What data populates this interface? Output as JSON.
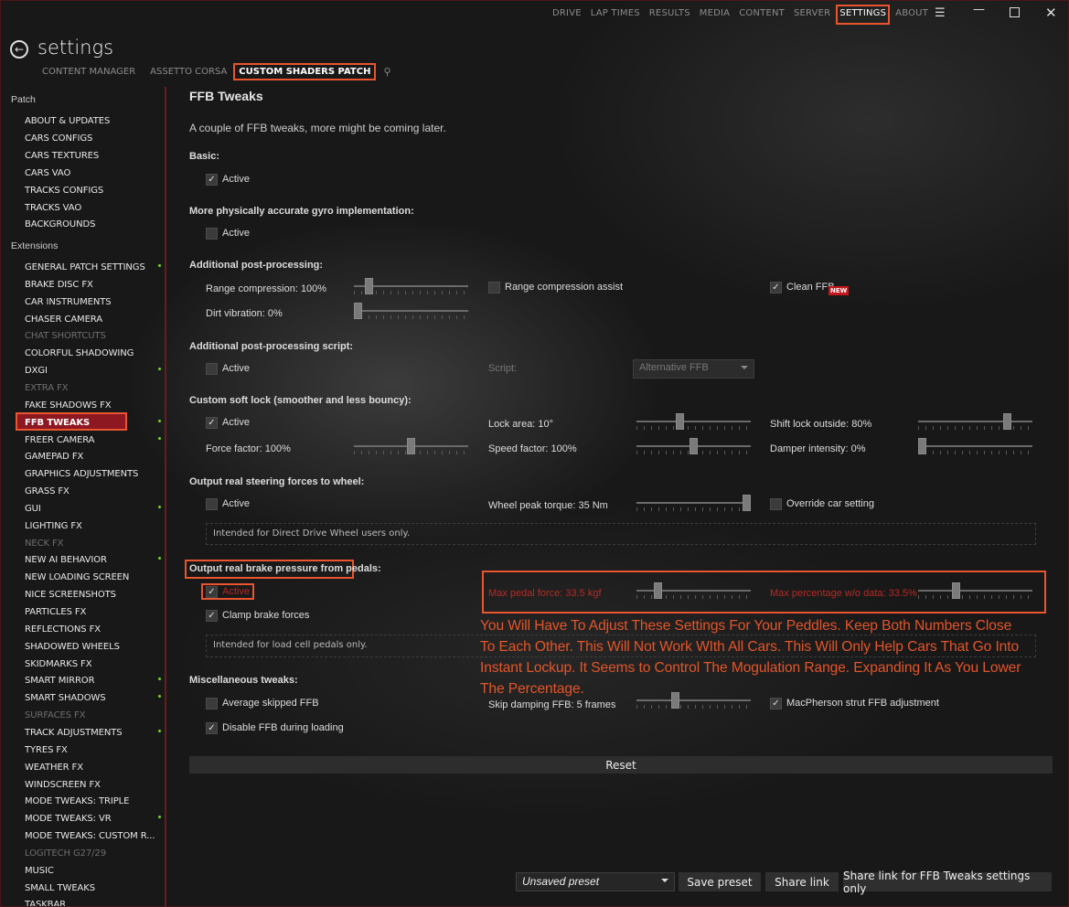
{
  "topnav": {
    "items": [
      "DRIVE",
      "LAP TIMES",
      "RESULTS",
      "MEDIA",
      "CONTENT",
      "SERVER",
      "SETTINGS",
      "ABOUT"
    ],
    "active": "SETTINGS"
  },
  "window": {
    "menu_icon": "hamburger-icon",
    "min_icon": "minimize-icon",
    "max_icon": "maximize-icon",
    "close_icon": "close-icon"
  },
  "page": {
    "title": "settings"
  },
  "subtabs": {
    "items": [
      "CONTENT MANAGER",
      "ASSETTO CORSA",
      "CUSTOM SHADERS PATCH"
    ],
    "active": "CUSTOM SHADERS PATCH",
    "search_icon": "search-icon"
  },
  "sidebar": {
    "patch_heading": "Patch",
    "patch_items": [
      "ABOUT & UPDATES",
      "CARS CONFIGS",
      "CARS TEXTURES",
      "CARS VAO",
      "TRACKS CONFIGS",
      "TRACKS VAO",
      "BACKGROUNDS"
    ],
    "ext_heading": "Extensions",
    "ext_items": [
      {
        "label": "GENERAL PATCH SETTINGS",
        "dim": false,
        "dot": true
      },
      {
        "label": "BRAKE DISC FX",
        "dim": false,
        "dot": false
      },
      {
        "label": "CAR INSTRUMENTS",
        "dim": false,
        "dot": false
      },
      {
        "label": "CHASER CAMERA",
        "dim": false,
        "dot": false
      },
      {
        "label": "CHAT SHORTCUTS",
        "dim": true,
        "dot": false
      },
      {
        "label": "COLORFUL SHADOWING",
        "dim": false,
        "dot": false
      },
      {
        "label": "DXGI",
        "dim": false,
        "dot": true
      },
      {
        "label": "EXTRA FX",
        "dim": true,
        "dot": false
      },
      {
        "label": "FAKE SHADOWS FX",
        "dim": false,
        "dot": false
      },
      {
        "label": "FFB TWEAKS",
        "dim": false,
        "dot": true,
        "selected": true
      },
      {
        "label": "FREER CAMERA",
        "dim": false,
        "dot": true
      },
      {
        "label": "GAMEPAD FX",
        "dim": false,
        "dot": false
      },
      {
        "label": "GRAPHICS ADJUSTMENTS",
        "dim": false,
        "dot": false
      },
      {
        "label": "GRASS FX",
        "dim": false,
        "dot": false
      },
      {
        "label": "GUI",
        "dim": false,
        "dot": true
      },
      {
        "label": "LIGHTING FX",
        "dim": false,
        "dot": false
      },
      {
        "label": "NECK FX",
        "dim": true,
        "dot": false
      },
      {
        "label": "NEW AI BEHAVIOR",
        "dim": false,
        "dot": true
      },
      {
        "label": "NEW LOADING SCREEN",
        "dim": false,
        "dot": false
      },
      {
        "label": "NICE SCREENSHOTS",
        "dim": false,
        "dot": false
      },
      {
        "label": "PARTICLES FX",
        "dim": false,
        "dot": false
      },
      {
        "label": "REFLECTIONS FX",
        "dim": false,
        "dot": false
      },
      {
        "label": "SHADOWED WHEELS",
        "dim": false,
        "dot": false
      },
      {
        "label": "SKIDMARKS FX",
        "dim": false,
        "dot": false
      },
      {
        "label": "SMART MIRROR",
        "dim": false,
        "dot": true
      },
      {
        "label": "SMART SHADOWS",
        "dim": false,
        "dot": true
      },
      {
        "label": "SURFACES FX",
        "dim": true,
        "dot": false
      },
      {
        "label": "TRACK ADJUSTMENTS",
        "dim": false,
        "dot": true
      },
      {
        "label": "TYRES FX",
        "dim": false,
        "dot": false
      },
      {
        "label": "WEATHER FX",
        "dim": false,
        "dot": false
      },
      {
        "label": "WINDSCREEN FX",
        "dim": false,
        "dot": false
      },
      {
        "label": "MODE TWEAKS: TRIPLE",
        "dim": false,
        "dot": false
      },
      {
        "label": "MODE TWEAKS: VR",
        "dim": false,
        "dot": true
      },
      {
        "label": "MODE TWEAKS: CUSTOM R...",
        "dim": false,
        "dot": false
      },
      {
        "label": "LOGITECH G27/29",
        "dim": true,
        "dot": false
      },
      {
        "label": "MUSIC",
        "dim": false,
        "dot": false
      },
      {
        "label": "SMALL TWEAKS",
        "dim": false,
        "dot": false
      },
      {
        "label": "TASKBAR",
        "dim": false,
        "dot": false
      }
    ]
  },
  "main": {
    "title": "FFB Tweaks",
    "description": "A couple of FFB tweaks, more might be coming later.",
    "basic": {
      "heading": "Basic:",
      "active_label": "Active",
      "active": true
    },
    "gyro": {
      "heading": "More physically accurate gyro implementation:",
      "active_label": "Active",
      "active": false
    },
    "post": {
      "heading": "Additional post-processing:",
      "range_label": "Range compression: 100%",
      "range_value": 0.1,
      "dirt_label": "Dirt vibration: 0%",
      "dirt_value": 0,
      "assist_label": "Range compression assist",
      "assist": false,
      "clean_label": "Clean FFB",
      "clean": true,
      "new_badge": "NEW"
    },
    "script": {
      "heading": "Additional post-processing script:",
      "active_label": "Active",
      "active": false,
      "script_label": "Script:",
      "script_value": "Alternative FFB"
    },
    "softlock": {
      "heading": "Custom soft lock (smoother and less bouncy):",
      "active_label": "Active",
      "active": true,
      "lock_label": "Lock area: 10°",
      "lock_value": 0.37,
      "shift_label": "Shift lock outside: 80%",
      "shift_value": 0.8,
      "force_label": "Force factor: 100%",
      "force_value": 0.5,
      "speed_label": "Speed factor: 100%",
      "speed_value": 0.5,
      "damper_label": "Damper intensity: 0%",
      "damper_value": 0
    },
    "steering": {
      "heading": "Output real steering forces to wheel:",
      "active_label": "Active",
      "active": false,
      "torque_label": "Wheel peak torque: 35 Nm",
      "torque_value": 1.0,
      "override_label": "Override car setting",
      "override": false,
      "note": "Intended for Direct Drive Wheel users only."
    },
    "brake": {
      "heading": "Output real brake pressure from pedals:",
      "active_label": "Active",
      "active": true,
      "clamp_label": "Clamp brake forces",
      "clamp": true,
      "maxforce_label": "Max pedal force: 33.5 kgf",
      "maxforce_value": 0.16,
      "maxperc_label": "Max percentage w/o data: 33.5%",
      "maxperc_value": 0.32,
      "note": "Intended for load cell pedals only."
    },
    "annotation": "You Will Have To Adjust These Settings For Your Peddles. Keep Both Numbers Close To Each Other.  This Will Not Work WIth All Cars. This Will Only Help Cars That Go Into Instant Lockup.  It Seems to Control The Mogulation Range. Expanding It As You Lower The Percentage.",
    "misc": {
      "heading": "Miscellaneous tweaks:",
      "avg_label": "Average skipped FFB",
      "avg": false,
      "disable_label": "Disable FFB during loading",
      "disable": true,
      "skip_label": "Skip damping FFB: 5 frames",
      "skip_value": 0.33,
      "mac_label": "MacPherson strut FFB adjustment",
      "mac": true
    },
    "reset_label": "Reset"
  },
  "footer": {
    "preset_value": "Unsaved preset",
    "save_label": "Save preset",
    "share_label": "Share link",
    "share_ffb_label": "Share link for FFB Tweaks settings only"
  },
  "colors": {
    "accent": "#e8552e",
    "selected": "#8d1822",
    "dot": "#7ed321",
    "badge": "#c4161c"
  }
}
